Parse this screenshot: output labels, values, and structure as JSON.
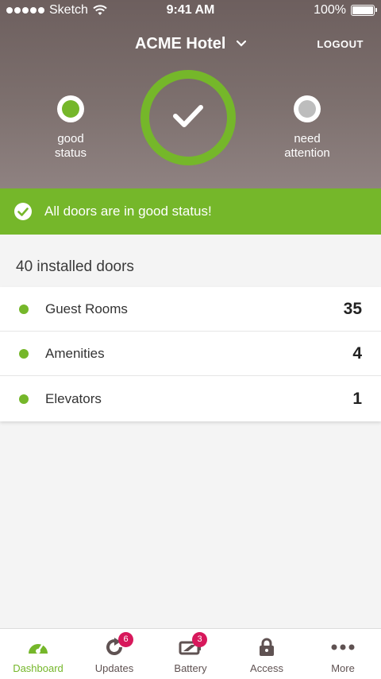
{
  "status_bar": {
    "carrier": "Sketch",
    "time": "9:41 AM",
    "battery": "100%"
  },
  "header": {
    "hotel": "ACME Hotel",
    "logout": "LOGOUT",
    "good_label_1": "good",
    "good_label_2": "status",
    "need_label_1": "need",
    "need_label_2": "attention"
  },
  "banner": {
    "message": "All doors are in good status!"
  },
  "doors": {
    "title": "40 installed doors",
    "items": [
      {
        "label": "Guest Rooms",
        "count": "35"
      },
      {
        "label": "Amenities",
        "count": "4"
      },
      {
        "label": "Elevators",
        "count": "1"
      }
    ]
  },
  "tabs": [
    {
      "label": "Dashboard",
      "icon": "dashboard-icon",
      "active": true
    },
    {
      "label": "Updates",
      "icon": "updates-icon",
      "badge": "6"
    },
    {
      "label": "Battery",
      "icon": "battery-icon",
      "badge": "3"
    },
    {
      "label": "Access",
      "icon": "lock-icon"
    },
    {
      "label": "More",
      "icon": "more-icon"
    }
  ],
  "colors": {
    "accent": "#75b72a",
    "badge": "#d7185b",
    "header": "#7a6c6b",
    "inactive": "#bdbdbd"
  }
}
